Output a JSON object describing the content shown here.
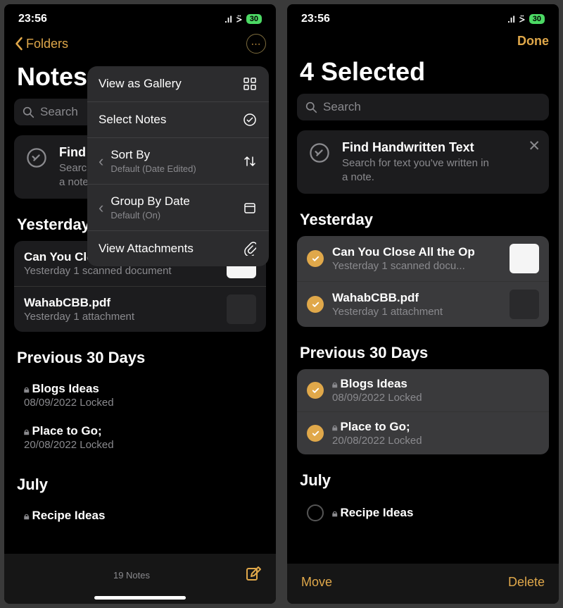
{
  "status": {
    "time": "23:56",
    "battery": "30"
  },
  "left": {
    "back": "Folders",
    "title": "Notes",
    "search_placeholder": "Search",
    "info": {
      "title": "Find Handwritten Text",
      "sub_a": "Search for text you've written in",
      "sub_b": "a note."
    },
    "menu": {
      "view_gallery": "View as Gallery",
      "select_notes": "Select Notes",
      "sort_by": "Sort By",
      "sort_sub": "Default (Date Edited)",
      "group_by": "Group By Date",
      "group_sub": "Default (On)",
      "view_attach": "View Attachments"
    },
    "sec1": "Yesterday",
    "notes1": [
      {
        "title": "Can You Close All the Op",
        "sub": "Yesterday  1 scanned document"
      },
      {
        "title": "WahabCBB.pdf",
        "sub": "Yesterday  1 attachment"
      }
    ],
    "sec2": "Previous 30 Days",
    "notes2": [
      {
        "title": "Blogs Ideas",
        "sub": "08/09/2022  Locked"
      },
      {
        "title": "Place to Go;",
        "sub": "20/08/2022  Locked"
      }
    ],
    "sec3": "July",
    "notes3": [
      {
        "title": "Recipe Ideas"
      }
    ],
    "footer_count": "19 Notes"
  },
  "right": {
    "done": "Done",
    "title": "4 Selected",
    "search_placeholder": "Search",
    "info": {
      "title": "Find Handwritten Text",
      "sub_a": "Search for text you've written in",
      "sub_b": "a note."
    },
    "sec1": "Yesterday",
    "notes1": [
      {
        "title": "Can You Close All the Op",
        "sub": "Yesterday  1 scanned docu..."
      },
      {
        "title": "WahabCBB.pdf",
        "sub": "Yesterday  1 attachment"
      }
    ],
    "sec2": "Previous 30 Days",
    "notes2": [
      {
        "title": "Blogs Ideas",
        "sub": "08/09/2022  Locked"
      },
      {
        "title": "Place to Go;",
        "sub": "20/08/2022  Locked"
      }
    ],
    "sec3": "July",
    "notes3": [
      {
        "title": "Recipe Ideas"
      }
    ],
    "move": "Move",
    "delete": "Delete"
  }
}
